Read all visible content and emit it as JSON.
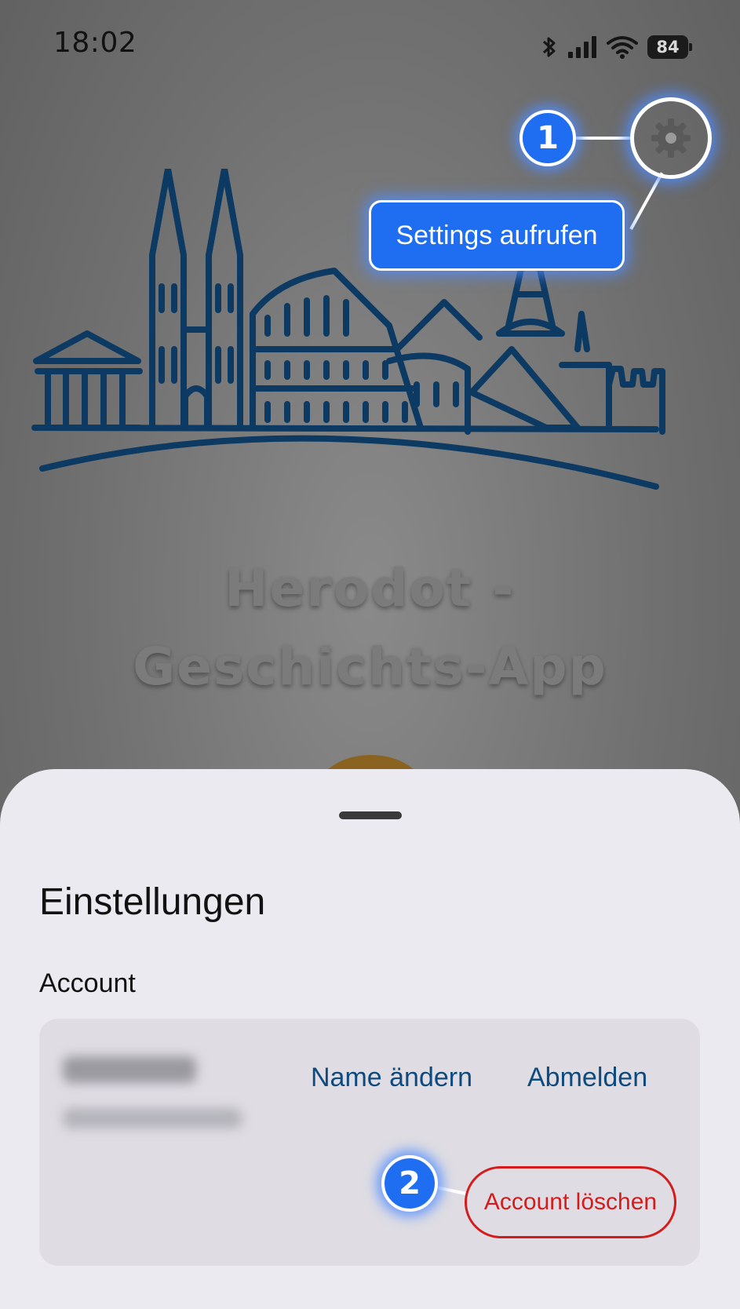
{
  "status_bar": {
    "time": "18:02",
    "battery": "84",
    "icons": [
      "bluetooth-icon",
      "signal-icon",
      "wifi-icon",
      "battery-icon"
    ]
  },
  "app": {
    "title_line1": "Herodot -",
    "title_line2": "Geschichts-App",
    "illustration": "skyline-illustration"
  },
  "annotations": {
    "step1": {
      "number": "1",
      "label": "Settings aufrufen",
      "target_icon": "gear-icon"
    },
    "step2": {
      "number": "2"
    }
  },
  "settings_sheet": {
    "title": "Einstellungen",
    "section": "Account",
    "actions": {
      "rename": "Name ändern",
      "logout": "Abmelden",
      "delete": "Account löschen"
    }
  },
  "colors": {
    "accent_blue": "#1f6ef2",
    "link_blue": "#0e4a7e",
    "danger_red": "#d31d1d",
    "skyline_navy": "#0d3a63",
    "sheet_bg": "#ebeaf0"
  }
}
